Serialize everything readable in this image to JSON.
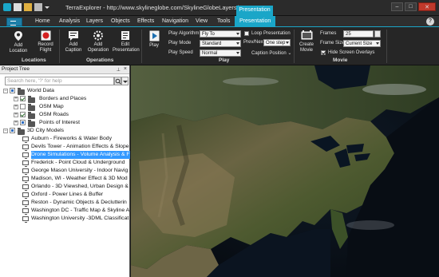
{
  "window": {
    "app_name": "TerraExplorer",
    "title": "TerraExplorer - http://www.skylineglobe.com/SkylineGlobeLayers/SG_E...",
    "context_tab": "Presentation"
  },
  "tabs": [
    "Home",
    "Analysis",
    "Layers",
    "Objects",
    "Effects",
    "Navigation",
    "View",
    "Tools",
    "Presentation"
  ],
  "active_tab": "Presentation",
  "ribbon": {
    "locations": {
      "group_label": "Locations",
      "add_location": "Add Location",
      "record_flight": "Record Flight"
    },
    "operations": {
      "group_label": "Operations",
      "add_caption": "Add Caption",
      "add_operation": "Add Operation",
      "edit_presentation": "Edit Presentation"
    },
    "play": {
      "group_label": "Play",
      "play_button": "Play",
      "play_algorithm_label": "Play Algorithm",
      "play_algorithm_value": "Fly To",
      "play_mode_label": "Play Mode",
      "play_mode_value": "Standard",
      "play_speed_label": "Play Speed",
      "play_speed_value": "Normal",
      "loop_label": "Loop Presentation",
      "prev_next_label": "Prev/Next",
      "prev_next_value": "One step",
      "caption_position_label": "Caption Position"
    },
    "movie": {
      "group_label": "Movie",
      "create_movie": "Create Movie",
      "frames_label": "Frames",
      "frames_value": "25",
      "frame_size_label": "Frame Size",
      "frame_size_value": "Current Size",
      "hide_overlays_label": "Hide Screen Overlays"
    }
  },
  "project_tree": {
    "title": "Project Tree",
    "search_placeholder": "Search here, '?' for help",
    "items": [
      {
        "label": "World Data",
        "level": 0,
        "type": "folder",
        "checked": "partial",
        "expanded": true
      },
      {
        "label": "Borders and Places",
        "level": 1,
        "type": "folder",
        "checked": "on"
      },
      {
        "label": "OSM Map",
        "level": 1,
        "type": "folder",
        "checked": "off"
      },
      {
        "label": "OSM Roads",
        "level": 1,
        "type": "folder",
        "checked": "on"
      },
      {
        "label": "Points of Interest",
        "level": 1,
        "type": "folder",
        "checked": "partial"
      },
      {
        "label": "3D City Models",
        "level": 0,
        "type": "folder",
        "checked": "partial"
      },
      {
        "label": "Auburn - Fireworks & Water Body",
        "level": 1,
        "type": "presentation"
      },
      {
        "label": "Devils Tower - Animation Effects & Slope",
        "level": 1,
        "type": "presentation"
      },
      {
        "label": "Drone Simulations - Volume Analysis & F",
        "level": 1,
        "type": "presentation",
        "selected": true
      },
      {
        "label": "Frederick - Point Cloud & Underground",
        "level": 1,
        "type": "presentation"
      },
      {
        "label": "George Mason University - Indoor Navig",
        "level": 1,
        "type": "presentation"
      },
      {
        "label": "Madison, WI - Weather Effect & 3D Mod",
        "level": 1,
        "type": "presentation"
      },
      {
        "label": "Orlando - 3D Viewshed, Urban Design &",
        "level": 1,
        "type": "presentation"
      },
      {
        "label": "Oxford - Power Lines & Buffer",
        "level": 1,
        "type": "presentation"
      },
      {
        "label": "Reston - Dynamic Objects & Declutterin",
        "level": 1,
        "type": "presentation"
      },
      {
        "label": "Washington DC - Traffic Map & Skyline A",
        "level": 1,
        "type": "presentation"
      },
      {
        "label": "Washington University -3DML Classificat",
        "level": 1,
        "type": "presentation"
      }
    ]
  },
  "colors": {
    "accent": "#1aa6c8",
    "selection": "#3399ff"
  }
}
